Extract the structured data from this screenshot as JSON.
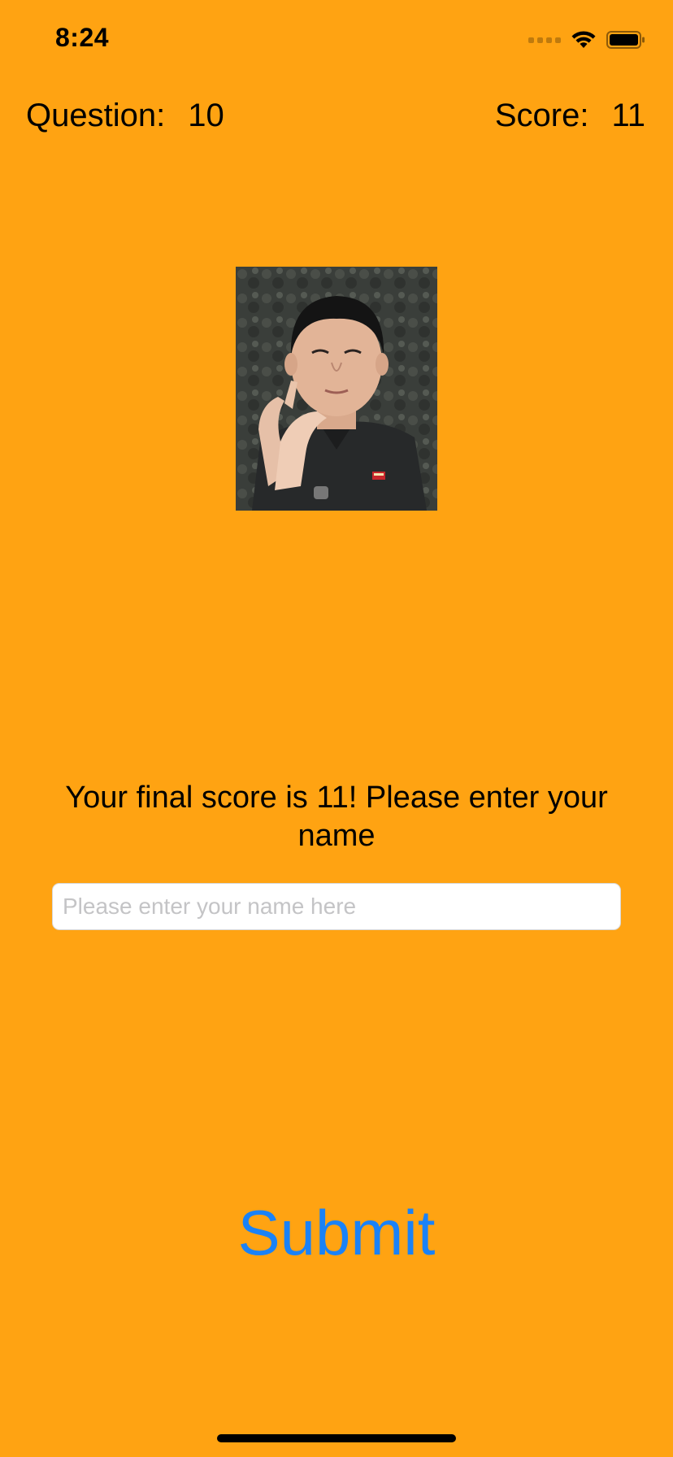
{
  "status_bar": {
    "time": "8:24",
    "icons": [
      "signal-icon",
      "wifi-icon",
      "battery-icon"
    ]
  },
  "hud": {
    "question_label": "Question:",
    "question_value": "10",
    "score_label": "Score:",
    "score_value": "11"
  },
  "photo": {
    "icon": "portrait-photo"
  },
  "prompt": {
    "text": "Your final score is 11! Please enter your name"
  },
  "name_field": {
    "placeholder": "Please enter your name here",
    "value": ""
  },
  "submit": {
    "label": "Submit"
  },
  "colors": {
    "background": "#FFA312",
    "accent": "#1A82F7",
    "field_bg": "#FFFFFF",
    "placeholder": "#C4C4C6"
  }
}
